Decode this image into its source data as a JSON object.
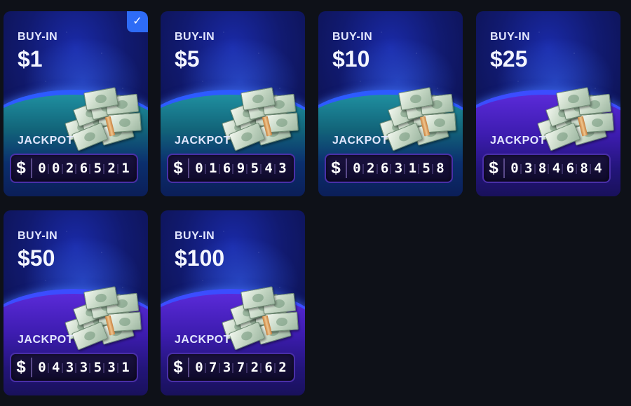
{
  "cards": [
    {
      "buyin_label": "BUY-IN",
      "amount": "$1",
      "jackpot_label": "JACKPOT",
      "currency": "$",
      "digits": [
        "0",
        "0",
        "2",
        "6",
        "5",
        "2",
        "1"
      ],
      "selected": true,
      "table_color": "teal"
    },
    {
      "buyin_label": "BUY-IN",
      "amount": "$5",
      "jackpot_label": "JACKPOT",
      "currency": "$",
      "digits": [
        "0",
        "1",
        "6",
        "9",
        "5",
        "4",
        "3"
      ],
      "selected": false,
      "table_color": "teal"
    },
    {
      "buyin_label": "BUY-IN",
      "amount": "$10",
      "jackpot_label": "JACKPOT",
      "currency": "$",
      "digits": [
        "0",
        "2",
        "6",
        "3",
        "1",
        "5",
        "8"
      ],
      "selected": false,
      "table_color": "teal"
    },
    {
      "buyin_label": "BUY-IN",
      "amount": "$25",
      "jackpot_label": "JACKPOT",
      "currency": "$",
      "digits": [
        "0",
        "3",
        "8",
        "4",
        "6",
        "8",
        "4"
      ],
      "selected": false,
      "table_color": "purple"
    },
    {
      "buyin_label": "BUY-IN",
      "amount": "$50",
      "jackpot_label": "JACKPOT",
      "currency": "$",
      "digits": [
        "0",
        "4",
        "3",
        "3",
        "5",
        "3",
        "1"
      ],
      "selected": false,
      "table_color": "purple"
    },
    {
      "buyin_label": "BUY-IN",
      "amount": "$100",
      "jackpot_label": "JACKPOT",
      "currency": "$",
      "digits": [
        "0",
        "7",
        "3",
        "7",
        "2",
        "6",
        "2"
      ],
      "selected": false,
      "table_color": "purple"
    }
  ],
  "check_glyph": "✓",
  "colors": {
    "background": "#0e1118",
    "accent": "#2e6cf6",
    "counter_border": "#4a2fa8"
  }
}
